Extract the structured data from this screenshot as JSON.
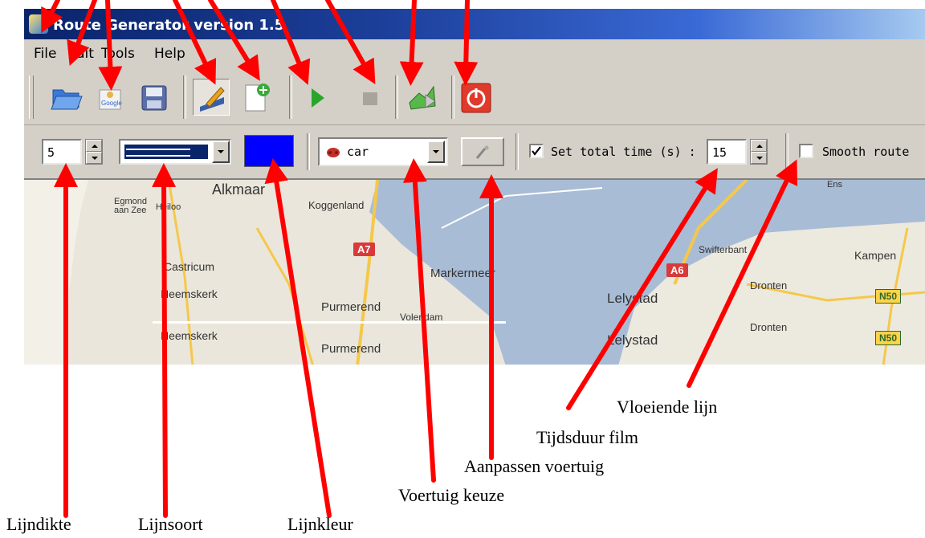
{
  "window": {
    "title": "Route Generator version 1.5"
  },
  "menu": [
    "File",
    "Edit",
    "Tools",
    "Help"
  ],
  "toolbar": {
    "icons": [
      "open-folder-icon",
      "google-icon",
      "save-disk-icon",
      "pen-edit-icon",
      "new-add-icon",
      "play-icon",
      "stop-icon",
      "vehicle-export-icon",
      "power-exit-icon"
    ]
  },
  "controls": {
    "line_width": "5",
    "vehicle": "car",
    "total_time_label": "Set total time (s) :",
    "total_time_value": "15",
    "smooth_label": "Smooth route",
    "line_color": "#0000ff"
  },
  "map": {
    "places": [
      "Alkmaar",
      "Egmond aan Zee",
      "Heiloo",
      "Koggenland",
      "Castricum",
      "Heemskerk",
      "Purmerend",
      "Volendam",
      "Markermeer",
      "Lelystad",
      "Swifterbant",
      "Dronten",
      "Kampen",
      "Ens"
    ],
    "roads": [
      "A7",
      "A6",
      "N50"
    ]
  },
  "captions": {
    "line_width": "Lijndikte",
    "line_type": "Lijnsoort",
    "line_color": "Lijnkleur",
    "vehicle_choice": "Voertuig keuze",
    "vehicle_edit": "Aanpassen voertuig",
    "duration": "Tijdsduur film",
    "smooth_line": "Vloeiende lijn"
  },
  "colors": {
    "arrow": "#ff0000",
    "title_bar": "#0a246a",
    "chrome": "#d4d0c8",
    "water": "#a9bcd6"
  }
}
